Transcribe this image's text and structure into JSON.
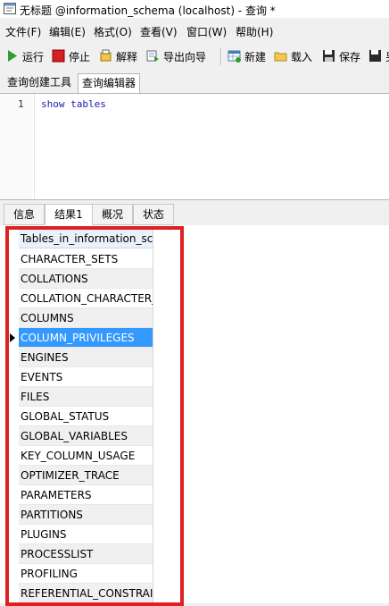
{
  "window": {
    "title": "无标题 @information_schema (localhost) - 查询 *"
  },
  "menu": [
    "文件(F)",
    "编辑(E)",
    "格式(O)",
    "查看(V)",
    "窗口(W)",
    "帮助(H)"
  ],
  "toolbar": {
    "run": "运行",
    "stop": "停止",
    "explain": "解释",
    "export": "导出向导",
    "new": "新建",
    "load": "载入",
    "save": "保存",
    "save_as": "另"
  },
  "query_tabs": [
    "查询创建工具",
    "查询编辑器"
  ],
  "editor": {
    "line_number": "1",
    "sql": "show tables"
  },
  "result_tabs": [
    "信息",
    "结果1",
    "概况",
    "状态"
  ],
  "results": {
    "column": "Tables_in_information_schema",
    "rows": [
      "CHARACTER_SETS",
      "COLLATIONS",
      "COLLATION_CHARACTER_SET_APPLICABILITY",
      "COLUMNS",
      "COLUMN_PRIVILEGES",
      "ENGINES",
      "EVENTS",
      "FILES",
      "GLOBAL_STATUS",
      "GLOBAL_VARIABLES",
      "KEY_COLUMN_USAGE",
      "OPTIMIZER_TRACE",
      "PARAMETERS",
      "PARTITIONS",
      "PLUGINS",
      "PROCESSLIST",
      "PROFILING",
      "REFERENTIAL_CONSTRAINTS"
    ],
    "selected_row": "COLUMN_PRIVILEGES"
  },
  "colors": {
    "selection": "#3399ff",
    "highlight_box": "#e02020"
  }
}
